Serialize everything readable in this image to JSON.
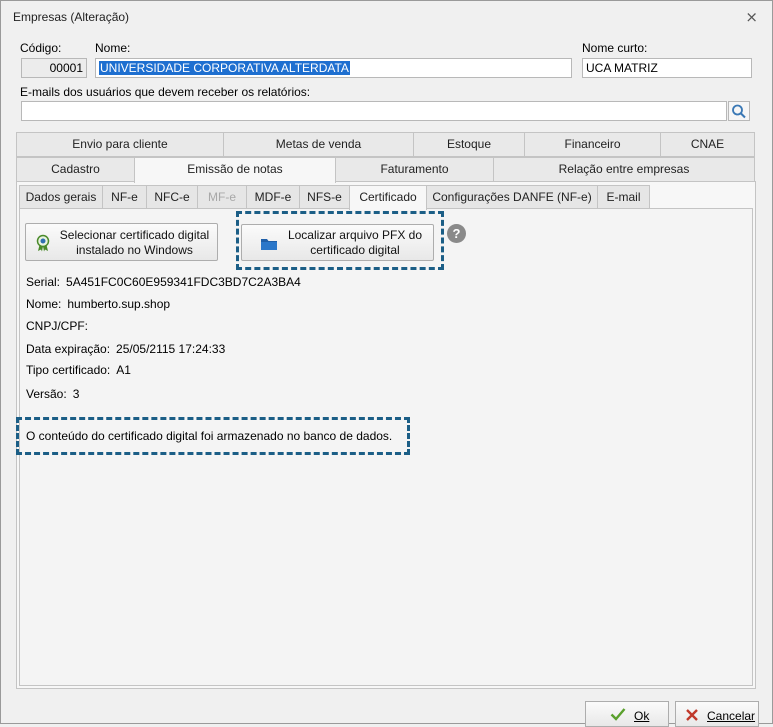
{
  "window": {
    "title": "Empresas (Alteração)",
    "close_glyph": "⨯"
  },
  "header": {
    "codigo_label": "Código:",
    "codigo_value": "00001",
    "nome_label": "Nome:",
    "nome_value": "UNIVERSIDADE CORPORATIVA ALTERDATA",
    "nome_curto_label": "Nome curto:",
    "nome_curto_value": "UCA MATRIZ",
    "emails_label": "E-mails dos usuários que devem receber os relatórios:",
    "emails_value": ""
  },
  "tabs_row1": [
    {
      "label": "Envio para cliente"
    },
    {
      "label": "Metas de venda"
    },
    {
      "label": "Estoque"
    },
    {
      "label": "Financeiro"
    },
    {
      "label": "CNAE"
    }
  ],
  "tabs_row2": [
    {
      "label": "Cadastro"
    },
    {
      "label": "Emissão de notas"
    },
    {
      "label": "Faturamento"
    },
    {
      "label": "Relação entre empresas"
    }
  ],
  "subtabs": [
    {
      "label": "Dados gerais"
    },
    {
      "label": "NF-e"
    },
    {
      "label": "NFC-e"
    },
    {
      "label": "MF-e"
    },
    {
      "label": "MDF-e"
    },
    {
      "label": "NFS-e"
    },
    {
      "label": "Certificado"
    },
    {
      "label": "Configurações DANFE (NF-e)"
    },
    {
      "label": "E-mail"
    }
  ],
  "certificado": {
    "btn_select_line1": "Selecionar certificado digital",
    "btn_select_line2": "instalado no Windows",
    "btn_locate_line1": "Localizar arquivo PFX do",
    "btn_locate_line2": "certificado digital",
    "help_glyph": "?",
    "serial_label": "Serial:",
    "serial_value": "5A451FC0C60E959341FDC3BD7C2A3BA4",
    "nome_label": "Nome:",
    "nome_value": "humberto.sup.shop",
    "cnpj_label": "CNPJ/CPF:",
    "cnpj_value": "",
    "expiracao_label": "Data expiração:",
    "expiracao_value": "25/05/2115 17:24:33",
    "tipo_label": "Tipo certificado:",
    "tipo_value": "A1",
    "versao_label": "Versão:",
    "versao_value": "3",
    "status_message": "O conteúdo do certificado digital foi armazenado no banco de dados."
  },
  "footer": {
    "ok_label": "Ok",
    "cancel_label": "Cancelar"
  },
  "colors": {
    "accent": "#1e6fd0",
    "dashed_highlight": "#1b5e86",
    "ok_check": "#5aa02c",
    "cancel_x": "#c0392b"
  }
}
